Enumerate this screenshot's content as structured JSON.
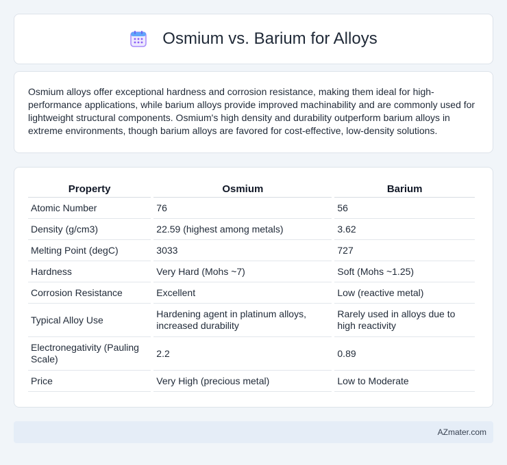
{
  "header": {
    "title": "Osmium vs. Barium for Alloys",
    "icon": "calendar-icon"
  },
  "intro": {
    "text": "Osmium alloys offer exceptional hardness and corrosion resistance, making them ideal for high-performance applications, while barium alloys provide improved machinability and are commonly used for lightweight structural components. Osmium's high density and durability outperform barium alloys in extreme environments, though barium alloys are favored for cost-effective, low-density solutions."
  },
  "table": {
    "headers": [
      "Property",
      "Osmium",
      "Barium"
    ],
    "rows": [
      [
        "Atomic Number",
        "76",
        "56"
      ],
      [
        "Density (g/cm3)",
        "22.59 (highest among metals)",
        "3.62"
      ],
      [
        "Melting Point (degC)",
        "3033",
        "727"
      ],
      [
        "Hardness",
        "Very Hard (Mohs ~7)",
        "Soft (Mohs ~1.25)"
      ],
      [
        "Corrosion Resistance",
        "Excellent",
        "Low (reactive metal)"
      ],
      [
        "Typical Alloy Use",
        "Hardening agent in platinum alloys, increased durability",
        "Rarely used in alloys due to high reactivity"
      ],
      [
        "Electronegativity (Pauling Scale)",
        "2.2",
        "0.89"
      ],
      [
        "Price",
        "Very High (precious metal)",
        "Low to Moderate"
      ]
    ]
  },
  "footer": {
    "brand": "AZmater.com"
  },
  "colors": {
    "background": "#f1f5f9",
    "card": "#ffffff",
    "footer": "#e5edf7",
    "icon_accent": "#8b7cf6"
  }
}
